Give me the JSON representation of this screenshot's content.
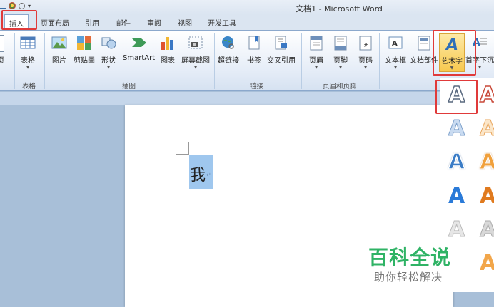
{
  "window": {
    "title": "文档1 - Microsoft Word"
  },
  "tabs": [
    {
      "label": "插入",
      "active": true
    },
    {
      "label": "页面布局"
    },
    {
      "label": "引用"
    },
    {
      "label": "邮件"
    },
    {
      "label": "审阅"
    },
    {
      "label": "视图"
    },
    {
      "label": "开发工具"
    }
  ],
  "ribbon": {
    "buttons": {
      "page": "页",
      "table": "表格",
      "picture": "图片",
      "clipart": "剪贴画",
      "shapes": "形状",
      "smartart": "SmartArt",
      "chart": "图表",
      "screenshot": "屏幕截图",
      "hyperlink": "超链接",
      "bookmark": "书签",
      "crossref": "交叉引用",
      "header": "页眉",
      "footer": "页脚",
      "pagenum": "页码",
      "textbox": "文本框",
      "quickparts": "文档部件",
      "wordart": "艺术字",
      "dropcap": "首字下沉"
    },
    "groups": {
      "tables": "表格",
      "illustrations": "插图",
      "links": "链接",
      "header_footer": "页眉和页脚"
    }
  },
  "document": {
    "text": "我",
    "paragraph_mark": "↵"
  },
  "wordart_gallery": {
    "sample": "A"
  },
  "watermark": {
    "title": "百科全说",
    "subtitle": "助你轻松解决"
  },
  "colors": {
    "highlight_box": "#e03a3a",
    "selection": "#9fc7ee",
    "watermark_green": "#2fb365"
  }
}
